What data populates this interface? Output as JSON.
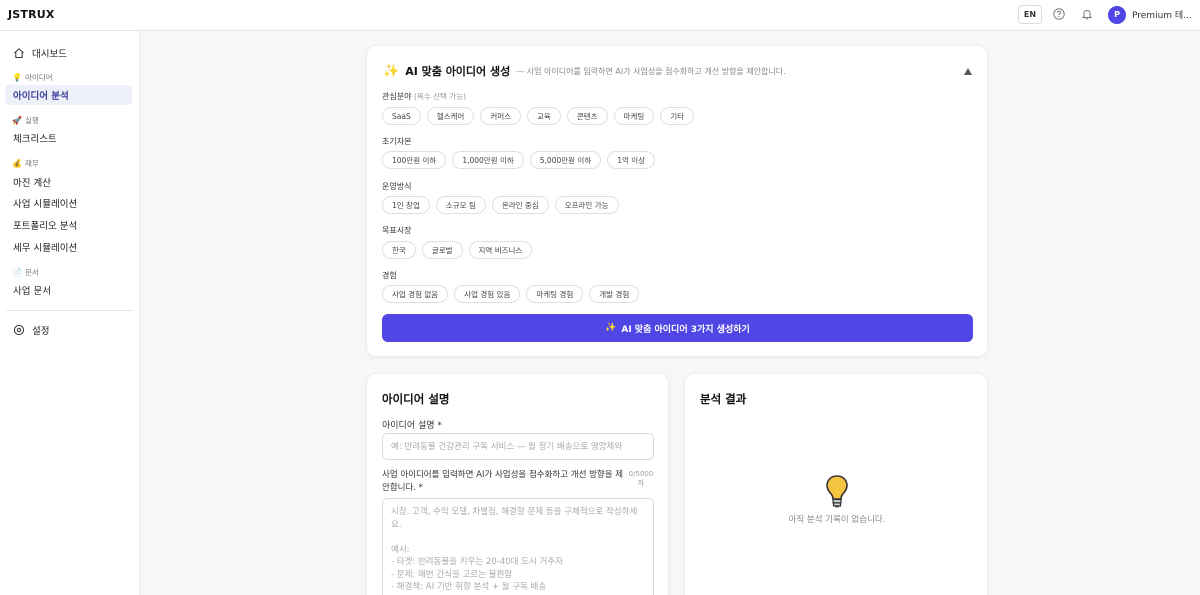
{
  "topbar": {
    "logo": "JSTRUX",
    "lang": "EN",
    "user_initial": "P",
    "user_name": "Premium 테..."
  },
  "sidebar": {
    "dashboard": "대시보드",
    "sections": [
      {
        "title": "아이디어",
        "emoji": "💡",
        "items": [
          "아이디어 분석"
        ]
      },
      {
        "title": "실행",
        "emoji": "🚀",
        "items": [
          "체크리스트"
        ]
      },
      {
        "title": "재무",
        "emoji": "💰",
        "items": [
          "마진 계산",
          "사업 시뮬레이션",
          "포트폴리오 분석",
          "세무 시뮬레이션"
        ]
      },
      {
        "title": "문서",
        "emoji": "📄",
        "items": [
          "사업 문서"
        ]
      }
    ],
    "settings": "설정",
    "active_item": "아이디어 분석"
  },
  "generator": {
    "icon": "✨",
    "title": "AI 맞춤 아이디어 생성",
    "subtitle": "— 사업 아이디어를 입력하면 AI가 사업성을 점수화하고 개선 방향을 제안합니다.",
    "groups": [
      {
        "label": "관심분야",
        "hint": "(복수 선택 가능)",
        "chips": [
          "SaaS",
          "헬스케어",
          "커머스",
          "교육",
          "콘텐츠",
          "마케팅",
          "기타"
        ]
      },
      {
        "label": "초기자본",
        "hint": "",
        "chips": [
          "100만원 이하",
          "1,000만원 이하",
          "5,000만원 이하",
          "1억 이상"
        ]
      },
      {
        "label": "운영방식",
        "hint": "",
        "chips": [
          "1인 창업",
          "소규모 팀",
          "온라인 중심",
          "오프라인 가능"
        ]
      },
      {
        "label": "목표시장",
        "hint": "",
        "chips": [
          "한국",
          "글로벌",
          "지역 비즈니스"
        ]
      },
      {
        "label": "경험",
        "hint": "",
        "chips": [
          "사업 경험 없음",
          "사업 경험 있음",
          "마케팅 경험",
          "개발 경험"
        ]
      }
    ],
    "button_icon": "✨",
    "button_label": "AI 맞춤 아이디어 3가지 생성하기"
  },
  "description": {
    "heading": "아이디어 설명",
    "field_label": "아이디어 설명 *",
    "field_placeholder": "예: 반려동물 건강관리 구독 서비스 — 월 정기 배송으로 영양제와",
    "textarea_label": "사업 아이디어를 입력하면 AI가 사업성을 점수화하고 개선 방향을 제안합니다. *",
    "counter": "0/5000자",
    "textarea_placeholder": "시장, 고객, 수익 모델, 차별점, 해결할 문제 등을 구체적으로 작성하세요.\n\n예시:\n- 타겟: 반려동물을 키우는 20-40대 도시 거주자\n- 문제: 매번 간식을 고르는 불편함\n- 해결책: AI 기반 취향 분석 + 월 구독 배송"
  },
  "result": {
    "heading": "분석 결과",
    "empty_message": "아직 분석 기록이 없습니다."
  },
  "colors": {
    "primary": "#4f46e5",
    "active_nav_bg": "#eef0f8",
    "bulb": "#f5c542"
  }
}
